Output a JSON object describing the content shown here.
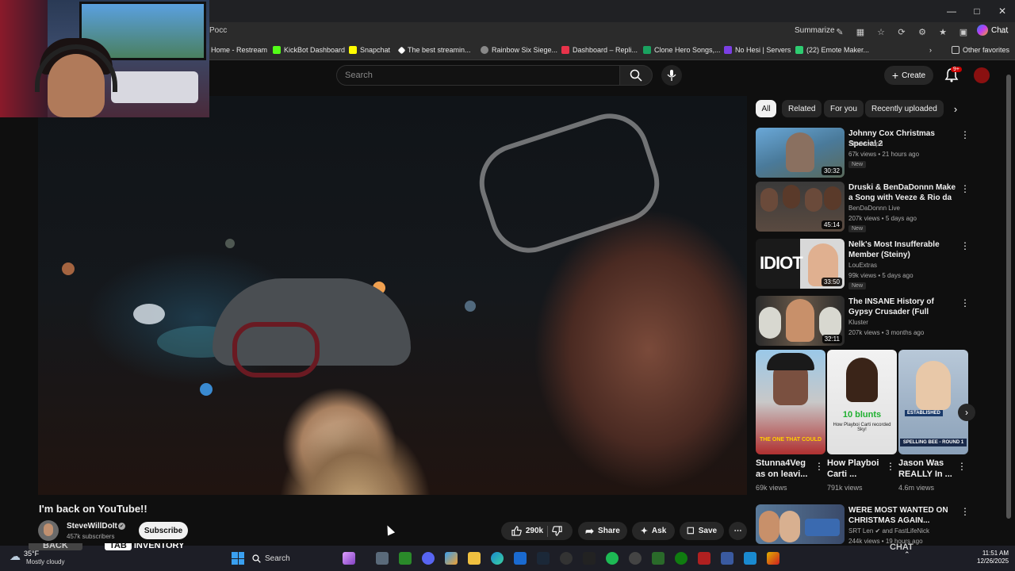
{
  "browser": {
    "url": "Pocc",
    "summarize_label": "Summarize",
    "chat_label": "Chat",
    "bookmarks": [
      {
        "label": "Home - Restream",
        "color": "#2a7ff7"
      },
      {
        "label": "KickBot Dashboard",
        "color": "#53fc18"
      },
      {
        "label": "Snapchat",
        "color": "#fffc00"
      },
      {
        "label": "The best streamin...",
        "color": "#ffffff"
      },
      {
        "label": "Rainbow Six Siege...",
        "color": "#cccccc"
      },
      {
        "label": "Dashboard – Repli...",
        "color": "#e8334a"
      },
      {
        "label": "Clone Hero Songs,...",
        "color": "#1aa260"
      },
      {
        "label": "No Hesi | Servers",
        "color": "#7b3fe4"
      },
      {
        "label": "(22) Emote Maker...",
        "color": "#2ecc71"
      }
    ],
    "other_favorites": "Other favorites"
  },
  "youtube": {
    "search_placeholder": "Search",
    "create_label": "Create",
    "notif_badge": "9+",
    "chips": [
      "All",
      "Related",
      "For you",
      "Recently uploaded"
    ],
    "video": {
      "title": "I'm back on YouTube!!",
      "channel": "SteveWillDoIt",
      "subscribers": "457k subscribers",
      "subscribe_label": "Subscribe",
      "likes": "290k",
      "share_label": "Share",
      "ask_label": "Ask",
      "save_label": "Save"
    },
    "recommendations": [
      {
        "title": "Johnny Cox Christmas Special 2",
        "channel": "Stackswopo",
        "meta": "67k views • 21 hours ago",
        "badge": "New",
        "duration": "30:32"
      },
      {
        "title": "Druski & BenDaDonnn Make a Song with Veeze & Rio da Yun...",
        "channel": "BenDaDonnn Live",
        "meta": "207k views • 5 days ago",
        "badge": "New",
        "duration": "45:14"
      },
      {
        "title": "Nelk's Most Insufferable Member (Steiny)",
        "channel": "LouExtras",
        "meta": "99k views • 5 days ago",
        "badge": "New",
        "duration": "33:50",
        "thumb_text": "IDIOT"
      },
      {
        "title": "The INSANE History of Gypsy Crusader (Full Documentary)",
        "channel": "Kluster",
        "meta": "207k views • 3 months ago",
        "badge": "",
        "duration": "32:11"
      },
      {
        "title": "WERE MOST WANTED ON CHRISTMAS AGAIN...",
        "channel": "SRT Len",
        "channel2": "and FastLifeNick",
        "meta": "244k views • 19 hours ago",
        "badge": "",
        "duration": ""
      }
    ],
    "shorts": [
      {
        "title": "Stunna4Veg as on leavi...",
        "views": "69k views",
        "caption": "THE ONE THAT COULD"
      },
      {
        "title": "How Playboi Carti ...",
        "views": "791k views",
        "caption": "10 blunts",
        "caption2": "How Playboi Carti recorded Sky!"
      },
      {
        "title": "Jason Was REALLY In ...",
        "views": "4.6m views",
        "caption": "SPELLING BEE - ROUND 1",
        "caption_top": "ESTABLISHED"
      }
    ]
  },
  "game_overlay": {
    "back_label": "BACK",
    "tab_label": "TAB",
    "inventory_label": "INVENTORY",
    "chat_label": "CHAT"
  },
  "taskbar": {
    "temperature": "35°F",
    "weather": "Mostly cloudy",
    "search_label": "Search",
    "time": "11:51 AM",
    "date": "12/26/2025"
  }
}
